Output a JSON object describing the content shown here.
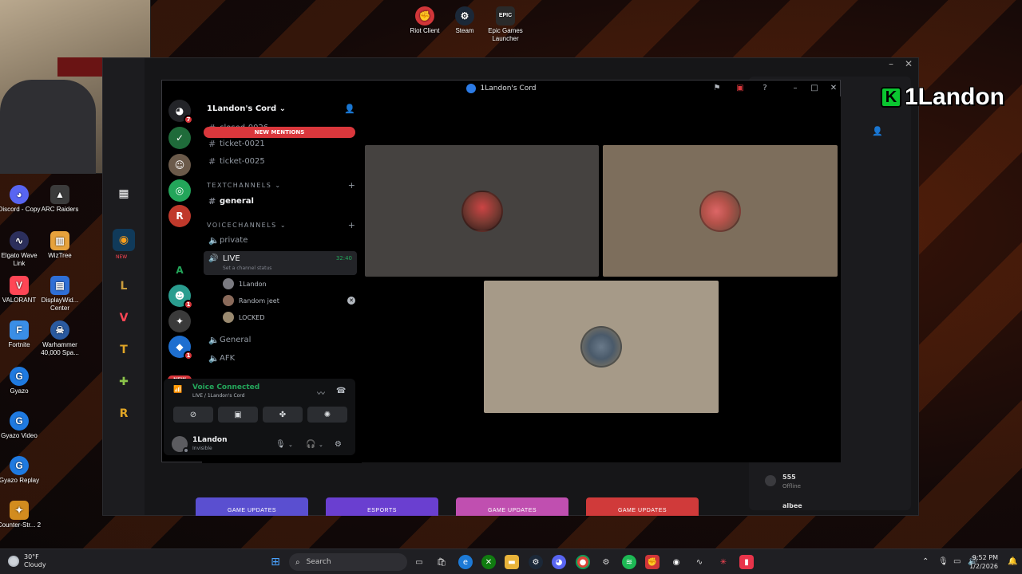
{
  "desktop": {
    "top_icons": [
      {
        "label": "Riot Client",
        "icon": "riot-icon",
        "color": "#d13639"
      },
      {
        "label": "Steam",
        "icon": "steam-icon",
        "color": "#1b2838"
      },
      {
        "label": "Epic Games Launcher",
        "icon": "epic-icon",
        "color": "#2a2a2a",
        "glyph": "EPIC"
      }
    ],
    "left_icons": [
      {
        "label": "Discord - Copy",
        "icon": "discord-icon",
        "color": "#5865f2"
      },
      {
        "label": "ARC Raiders",
        "icon": "arc-raiders-icon",
        "color": "#3b3b3b"
      },
      {
        "label": "Elgato Wave Link",
        "icon": "wave-link-icon",
        "color": "#2c2f5c"
      },
      {
        "label": "WizTree",
        "icon": "wiztree-icon",
        "color": "#e6a23c"
      },
      {
        "label": "VALORANT",
        "icon": "valorant-icon",
        "color": "#ff4655"
      },
      {
        "label": "DisplayWid... Center",
        "icon": "display-widget-icon",
        "color": "#2f6fd6"
      },
      {
        "label": "Fortnite",
        "icon": "fortnite-icon",
        "color": "#3a8ee6"
      },
      {
        "label": "Warhammer 40,000 Spa...",
        "icon": "warhammer-icon",
        "color": "#2a5aa0"
      },
      {
        "label": "Gyazo",
        "icon": "gyazo-icon",
        "color": "#1f7ae0"
      },
      {
        "label": "Gyazo Video",
        "icon": "gyazo-video-icon",
        "color": "#1f7ae0"
      },
      {
        "label": "Gyazo Replay",
        "icon": "gyazo-replay-icon",
        "color": "#1f7ae0"
      },
      {
        "label": "Counter-Str... 2",
        "icon": "counter-strike-icon",
        "color": "#d28c1f"
      }
    ]
  },
  "streamer_tag": {
    "badge": "K",
    "name": "1Landon"
  },
  "launcher": {
    "side_icons": [
      {
        "icon": "grid-icon",
        "glyph": "▦",
        "color": "#ffffff"
      },
      {
        "icon": "overwatch-icon",
        "glyph": "◉",
        "color": "#f99e1a",
        "badge": "NEW"
      },
      {
        "icon": "league-icon",
        "glyph": "L",
        "color": "#c89b3c"
      },
      {
        "icon": "valorant-icon",
        "glyph": "V",
        "color": "#ff4655"
      },
      {
        "icon": "tft-icon",
        "glyph": "T",
        "color": "#e0a526"
      },
      {
        "icon": "lor-icon",
        "glyph": "✚",
        "color": "#8bc34a"
      },
      {
        "icon": "riot-icon",
        "glyph": "R",
        "color": "#e0a526"
      }
    ],
    "cards": [
      {
        "label": "GAME UPDATES",
        "color": "#5a4fd0"
      },
      {
        "label": "ESPORTS",
        "color": "#6a3fd0"
      },
      {
        "label": "GAME UPDATES",
        "color": "#c04fb0"
      },
      {
        "label": "GAME UPDATES",
        "color": "#d03a3a"
      }
    ],
    "friend": {
      "name": "555",
      "status": "Offline",
      "next": "albee"
    }
  },
  "discord": {
    "window_title": "1Landon's Cord",
    "server_name": "1Landon's Cord",
    "new_mentions": "NEW MENTIONS",
    "servers": [
      {
        "icon": "discord-home-icon",
        "glyph": "◕",
        "color": "#232428",
        "badge": "7"
      },
      {
        "icon": "server-icon",
        "glyph": "✓",
        "color": "#1f6b3a",
        "badge": ""
      },
      {
        "icon": "server-icon",
        "glyph": "☺",
        "color": "#6b5a4a",
        "badge": ""
      },
      {
        "icon": "server-icon",
        "glyph": "◎",
        "color": "#23a55a",
        "badge": ""
      },
      {
        "icon": "server-icon",
        "glyph": "R",
        "color": "#c0392b",
        "badge": ""
      },
      {
        "icon": "server-icon",
        "glyph": "A",
        "color": "#000000",
        "badge": ""
      },
      {
        "icon": "server-icon",
        "glyph": "☻",
        "color": "#2a9d8f",
        "badge": "1"
      },
      {
        "icon": "server-icon",
        "glyph": "✦",
        "color": "#3a3a3a",
        "badge": ""
      },
      {
        "icon": "server-icon",
        "glyph": "◆",
        "color": "#1e6fd0",
        "badge": "1"
      }
    ],
    "new_label": "NEW",
    "channels_top": [
      "closed-0026",
      "ticket-0021",
      "ticket-0025"
    ],
    "text_category": "TEXTCHANNELS",
    "text_channels": [
      "general"
    ],
    "voice_category": "VOICECHANNELS",
    "voice_channels": [
      "private"
    ],
    "live_channel": {
      "name": "LIVE",
      "status": "Set a channel status",
      "time": "32:40"
    },
    "voice_users": [
      {
        "name": "1Landon",
        "avatar_color": "#7a7a80"
      },
      {
        "name": "Random jeet",
        "avatar_color": "#8a6a5a"
      },
      {
        "name": "LOCKED",
        "avatar_color": "#9a8a70"
      }
    ],
    "voice_channels_after": [
      "General",
      "AFK"
    ],
    "voice_panel": {
      "title": "Voice Connected",
      "subtitle": "LIVE / 1Landon's Cord"
    },
    "user": {
      "name": "1Landon",
      "status": "Invisible"
    },
    "tiles": [
      {
        "bg": "#454240",
        "avatar": "#7a3a32"
      },
      {
        "bg": "#7d6e5c",
        "avatar": "#b5524a"
      },
      {
        "bg": "#a69a88",
        "avatar": "#4a5a6a"
      }
    ]
  },
  "taskbar": {
    "weather_temp": "30°F",
    "weather_desc": "Cloudy",
    "search_label": "Search",
    "time": "9:52 PM",
    "date": "1/2/2026"
  }
}
